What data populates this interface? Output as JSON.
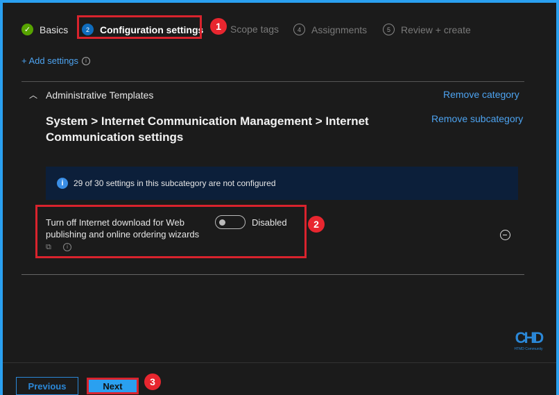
{
  "steps": [
    {
      "label": "Basics",
      "state": "complete"
    },
    {
      "num": "2",
      "label": "Configuration settings",
      "state": "current"
    },
    {
      "label": "Scope tags"
    },
    {
      "num": "4",
      "label": "Assignments"
    },
    {
      "num": "5",
      "label": "Review + create"
    }
  ],
  "add_settings": "+ Add settings",
  "category": {
    "title": "Administrative Templates",
    "remove_category": "Remove category",
    "subcategory_path": "System > Internet Communication Management > Internet Communication settings",
    "remove_subcategory": "Remove subcategory"
  },
  "info_banner": "29 of 30 settings in this subcategory are not configured",
  "setting": {
    "name": "Turn off Internet download for Web publishing and online ordering wizards",
    "toggle_label": "Disabled",
    "enabled": false
  },
  "annotations": [
    "1",
    "2",
    "3"
  ],
  "footer": {
    "previous": "Previous",
    "next": "Next"
  },
  "watermark": "HTMD Community",
  "colors": {
    "accent": "#2b88d8",
    "annotation": "#e8262f",
    "success": "#57a300"
  }
}
